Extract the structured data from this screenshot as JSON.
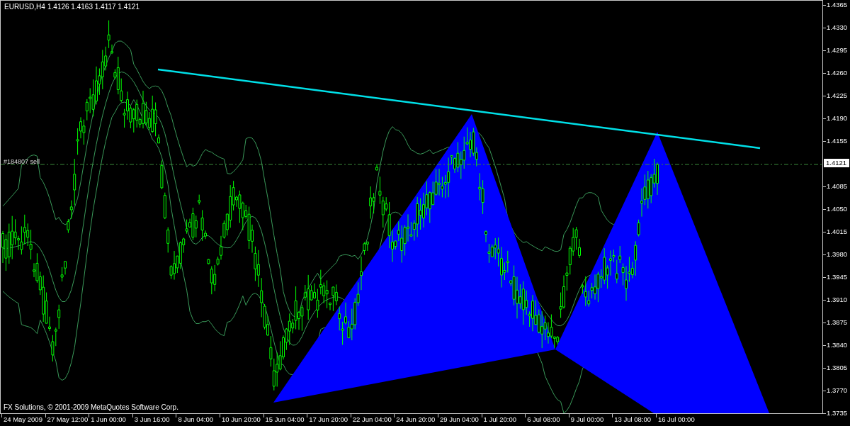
{
  "chart": {
    "symbol": "EURUSD,H4",
    "quote": "1.4126 1.4163 1.4117 1.4121",
    "order_label": "#184807 sell",
    "copyright": "FX Solutions, © 2001-2009 MetaQuotes Software Corp."
  },
  "price_axis": {
    "labels": [
      "1.4365",
      "1.4330",
      "1.4295",
      "1.4260",
      "1.4225",
      "1.4190",
      "1.4155",
      "1.4085",
      "1.4050",
      "1.4015",
      "1.3980",
      "1.3945",
      "1.3910",
      "1.3875",
      "1.3840",
      "1.3805",
      "1.3770",
      "1.3735"
    ],
    "current_price": "1.4121"
  },
  "time_axis": {
    "labels": [
      "24 May 2009",
      "27 May 12:00",
      "1 Jun 00:00",
      "3 Jun 16:00",
      "8 Jun 04:00",
      "10 Jun 20:00",
      "15 Jun 04:00",
      "17 Jun 20:00",
      "22 Jun 04:00",
      "24 Jun 20:00",
      "29 Jun 04:00",
      "1 Jul 20:00",
      "6 Jul 08:00",
      "9 Jul 00:00",
      "13 Jul 08:00",
      "16 Jul 00:00"
    ]
  }
}
